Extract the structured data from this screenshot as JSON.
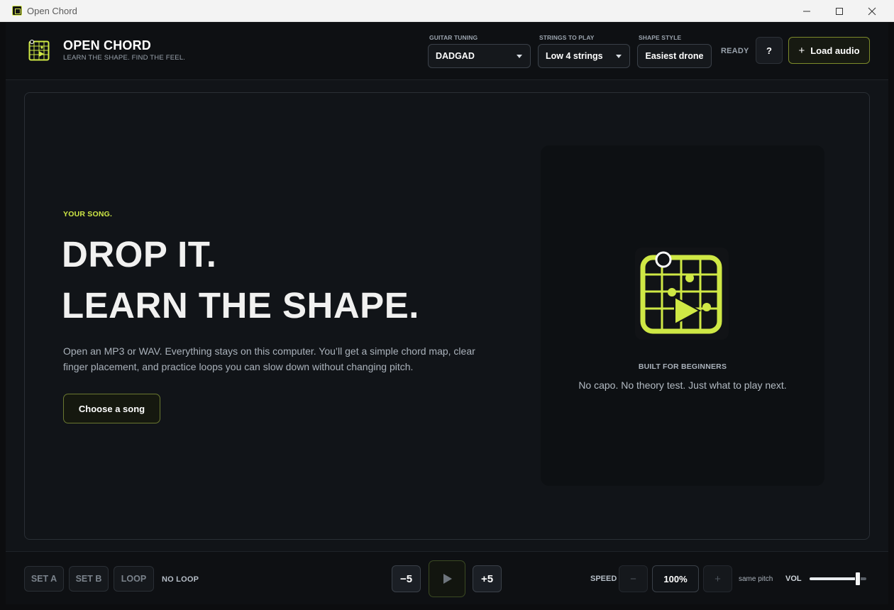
{
  "window": {
    "title": "Open Chord",
    "controls": {
      "minimize": "—",
      "maximize": "☐",
      "close": "✕"
    }
  },
  "header": {
    "logo_icon": "chord-grid-play-icon",
    "brand_name": "OPEN CHORD",
    "tagline": "LEARN THE SHAPE. FIND THE FEEL.",
    "tuning": {
      "label": "GUITAR TUNING",
      "value": "DADGAD"
    },
    "strings": {
      "label": "STRINGS TO PLAY",
      "value": "Low 4 strings"
    },
    "shape_style": {
      "label": "SHAPE STYLE",
      "value": "Easiest drone"
    },
    "status": "READY",
    "help_label": "?",
    "load_label": "Load audio",
    "load_icon": "+"
  },
  "main": {
    "eyebrow": "YOUR SONG.",
    "headline_1": "DROP IT.",
    "headline_2": "LEARN THE SHAPE.",
    "intro": "Open an MP3 or WAV. Everything stays on this computer. You’ll get a simple chord map, clear finger placement, and practice loops you can slow down without changing pitch.",
    "choose_label": "Choose a song",
    "panel": {
      "icon": "chord-grid-play-icon",
      "title": "BUILT FOR BEGINNERS",
      "subtitle": "No capo. No theory test. Just what to play next."
    }
  },
  "transport": {
    "set_a": "SET A",
    "set_b": "SET B",
    "loop": "LOOP",
    "loop_status": "NO LOOP",
    "back_label": "−5",
    "forward_label": "+5",
    "play_icon": "▶",
    "speed_label": "SPEED",
    "speed_minus": "−",
    "speed_value": "100%",
    "speed_plus": "+",
    "pitch_note": "same pitch",
    "vol_label": "VOL",
    "volume": 0.85
  },
  "colors": {
    "accent": "#cfe845",
    "background": "#111418",
    "panel": "#0d1013"
  }
}
